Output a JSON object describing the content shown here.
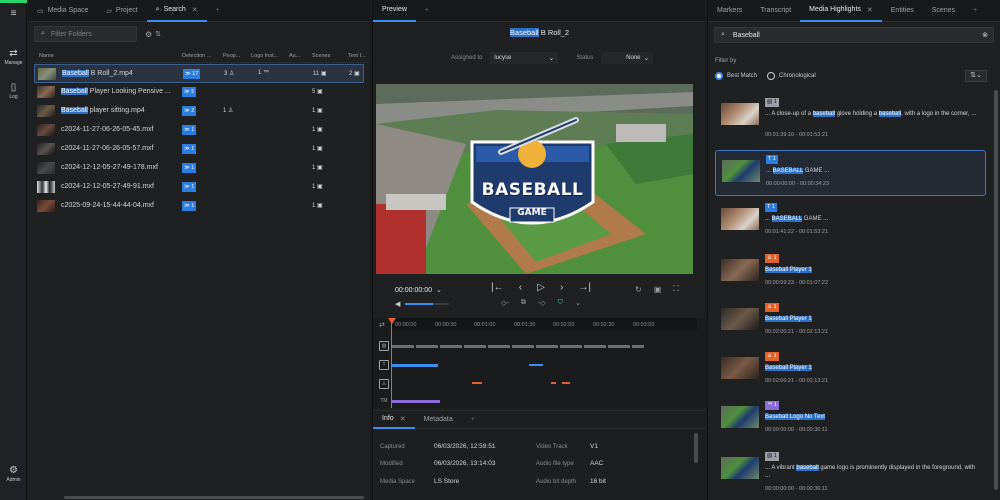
{
  "rail": {
    "items": [
      {
        "label": "Manage",
        "icon": "manage-icon"
      },
      {
        "label": "Log",
        "icon": "log-icon"
      }
    ],
    "bottom": {
      "label": "Admin",
      "icon": "gear-icon"
    }
  },
  "panel1": {
    "tabs": [
      {
        "label": "Media Space"
      },
      {
        "label": "Project"
      },
      {
        "label": "Search"
      }
    ],
    "filter_placeholder": "Filter Folders",
    "columns": [
      "Name",
      "Detection ...",
      "Peop...",
      "Logo Inst...",
      "Au...",
      "Scenes",
      "Text I..."
    ],
    "files": [
      {
        "name_hl": "Baseball",
        "name_rest": " B Roll_2.mp4",
        "detection": "17",
        "people": "3",
        "logo": "1",
        "scenes": "11",
        "text": "2",
        "selected": true
      },
      {
        "name_hl": "Baseball",
        "name_rest": " Player Looking Pensive ...",
        "detection": "5",
        "people": "",
        "logo": "",
        "scenes": "5",
        "text": ""
      },
      {
        "name_hl": "Baseball",
        "name_rest": " player sitting.mp4",
        "detection": "2",
        "people": "1",
        "logo": "",
        "scenes": "1",
        "text": ""
      },
      {
        "name_hl": "",
        "name_rest": "c2024-11-27-06-26-05-45.mxf",
        "detection": "1",
        "people": "",
        "logo": "",
        "scenes": "1",
        "text": ""
      },
      {
        "name_hl": "",
        "name_rest": "c2024-11-27-06-26-05-57.mxf",
        "detection": "1",
        "people": "",
        "logo": "",
        "scenes": "1",
        "text": ""
      },
      {
        "name_hl": "",
        "name_rest": "c2024-12-12-05-27-49-178.mxf",
        "detection": "1",
        "people": "",
        "logo": "",
        "scenes": "1",
        "text": ""
      },
      {
        "name_hl": "",
        "name_rest": "c2024-12-12-05-27-49-91.mxf",
        "detection": "1",
        "people": "",
        "logo": "",
        "scenes": "1",
        "text": ""
      },
      {
        "name_hl": "",
        "name_rest": "c2025-09-24-15-44-44-04.mxf",
        "detection": "1",
        "people": "",
        "logo": "",
        "scenes": "1",
        "text": ""
      }
    ]
  },
  "panel2": {
    "tab": "Preview",
    "title_hl": "Baseball",
    "title_rest": " B Roll_2",
    "assigned_label": "Assigned to",
    "assigned_value": "lucyse",
    "status_label": "Status",
    "status_value": "None",
    "logo_line1": "BASEBALL",
    "logo_line2": "GAME",
    "timecode": "00:00:00:00",
    "ruler": [
      "00:00:00",
      "00:00:30",
      "00:01:00",
      "00:01:30",
      "00:02:00",
      "00:02:30",
      "00:03:00"
    ],
    "track_icons": [
      "image-track-icon",
      "text-track-icon",
      "person-track-icon",
      "trademark-track-icon"
    ],
    "info_tabs": [
      "Info",
      "Metadata"
    ],
    "metadata": [
      {
        "label": "Captured",
        "value": "06/03/2026, 12:59:51"
      },
      {
        "label": "Modified",
        "value": "06/03/2026, 13:14:03"
      },
      {
        "label": "Media Space",
        "value": "LS Store"
      }
    ],
    "metadata_right": [
      {
        "label": "Video Track",
        "value": "V1"
      },
      {
        "label": "Audio file type",
        "value": "AAC"
      },
      {
        "label": "Audio bit depth",
        "value": "16 bit"
      }
    ]
  },
  "panel3": {
    "tabs": [
      "Markers",
      "Transcript",
      "Media Highlights",
      "Entities",
      "Scenes"
    ],
    "search_value": "Baseball",
    "filter_label": "Filter by",
    "options": [
      "Best Match",
      "Chronological"
    ],
    "results": [
      {
        "badge": "1",
        "badge_color": "gray",
        "pre": "... A close-up of a ",
        "hl": "baseball",
        "mid": " glove holding a ",
        "hl2": "baseball",
        "post": ", with a logo in the corner, ...",
        "time": "00:01:39:10 - 00:01:53:21"
      },
      {
        "badge": "1",
        "badge_color": "blue",
        "pre": "... ",
        "hl": "BASEBALL",
        "mid": " GAME ...",
        "hl2": "",
        "post": "",
        "time": "00:00:00:00 - 00:00:34:23",
        "selected": true
      },
      {
        "badge": "1",
        "badge_color": "blue",
        "pre": "... ",
        "hl": "BASEBALL",
        "mid": " GAME ...",
        "hl2": "",
        "post": "",
        "time": "00:01:41:22 - 00:01:53:21"
      },
      {
        "badge": "1",
        "badge_color": "orange",
        "pre": "",
        "hl": "Baseball Player 1",
        "mid": "",
        "hl2": "",
        "post": "",
        "time": "00:00:59:23 - 00:01:07:22"
      },
      {
        "badge": "1",
        "badge_color": "orange",
        "pre": "",
        "hl": "Baseball Player 1",
        "mid": "",
        "hl2": "",
        "post": "",
        "time": "00:02:00:21 - 00:02:13:21"
      },
      {
        "badge": "1",
        "badge_color": "orange",
        "pre": "",
        "hl": "Baseball Player 1",
        "mid": "",
        "hl2": "",
        "post": "",
        "time": "00:02:06:21 - 00:02:13:21"
      },
      {
        "badge": "1",
        "badge_color": "purple",
        "pre": "",
        "hl": "Baseball Logo No Text",
        "mid": "",
        "hl2": "",
        "post": "",
        "time": "00:00:00:00 - 00:00:36:11"
      },
      {
        "badge": "1",
        "badge_color": "gray",
        "pre": "... A vibrant ",
        "hl": "baseball",
        "mid": " game logo is prominently displayed in the foreground, with ...",
        "hl2": "",
        "post": "",
        "time": "00:00:00:00 - 00:00:36:11"
      }
    ]
  }
}
